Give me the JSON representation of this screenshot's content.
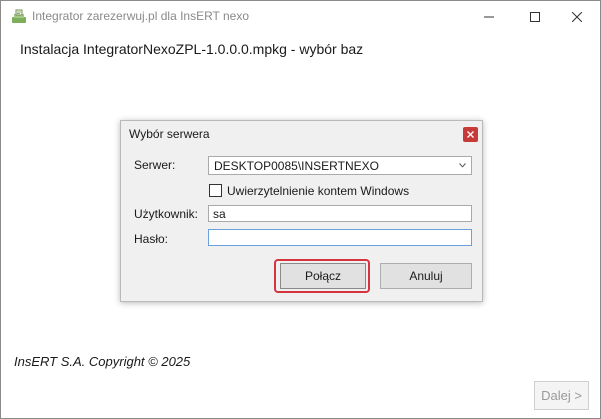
{
  "window": {
    "title": "Integrator zarezerwuj.pl dla InsERT nexo",
    "icon": "app-icon",
    "controls": [
      "minimize-icon",
      "maximize-icon",
      "close-icon"
    ]
  },
  "header": {
    "text": "Instalacja IntegratorNexoZPL-1.0.0.0.mpkg - wybór baz"
  },
  "dialog": {
    "title": "Wybór serwera",
    "server_label": "Serwer:",
    "server_value": "DESKTOP0085\\INSERTNEXO",
    "windows_auth_label": "Uwierzytelnienie kontem Windows",
    "windows_auth_checked": false,
    "user_label": "Użytkownik:",
    "user_value": "sa",
    "password_label": "Hasło:",
    "password_value": "",
    "connect_label": "Połącz",
    "cancel_label": "Anuluj"
  },
  "footer": {
    "copyright": "InsERT S.A. Copyright © 2025",
    "next_label": "Dalej >",
    "next_enabled": false
  },
  "colors": {
    "dialog_close": "#c73a3a",
    "highlight_outline": "#d6353f",
    "focus_border": "#6aa1dc"
  }
}
